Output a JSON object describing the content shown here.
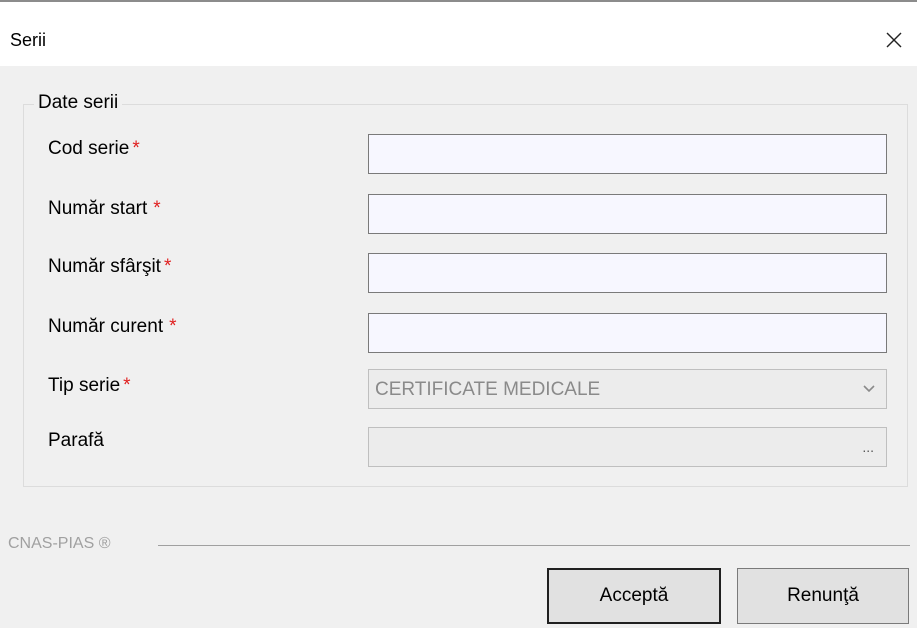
{
  "window": {
    "title": "Serii"
  },
  "group": {
    "legend": "Date serii"
  },
  "fields": [
    {
      "label": "Cod serie",
      "required_mark": "*",
      "value": ""
    },
    {
      "label": "Număr start",
      "required_mark": "*",
      "value": ""
    },
    {
      "label": "Număr sfârşit",
      "required_mark": "*",
      "value": ""
    },
    {
      "label": "Număr curent",
      "required_mark": "*",
      "value": ""
    }
  ],
  "tip_serie": {
    "label": "Tip serie",
    "required_mark": "*",
    "selected": "CERTIFICATE MEDICALE",
    "arrow_icon": "chevron-down-icon"
  },
  "parafa": {
    "label": "Parafă",
    "value": "",
    "browse_label": "..."
  },
  "footer": {
    "brand": "CNAS-PIAS ®"
  },
  "buttons": {
    "accept": "Acceptă",
    "cancel": "Renunţă"
  },
  "colors": {
    "required": "#e02020",
    "input_bg": "#f7f7ff",
    "disabled_bg": "#ececec",
    "window_bg": "#f0f0f0"
  }
}
